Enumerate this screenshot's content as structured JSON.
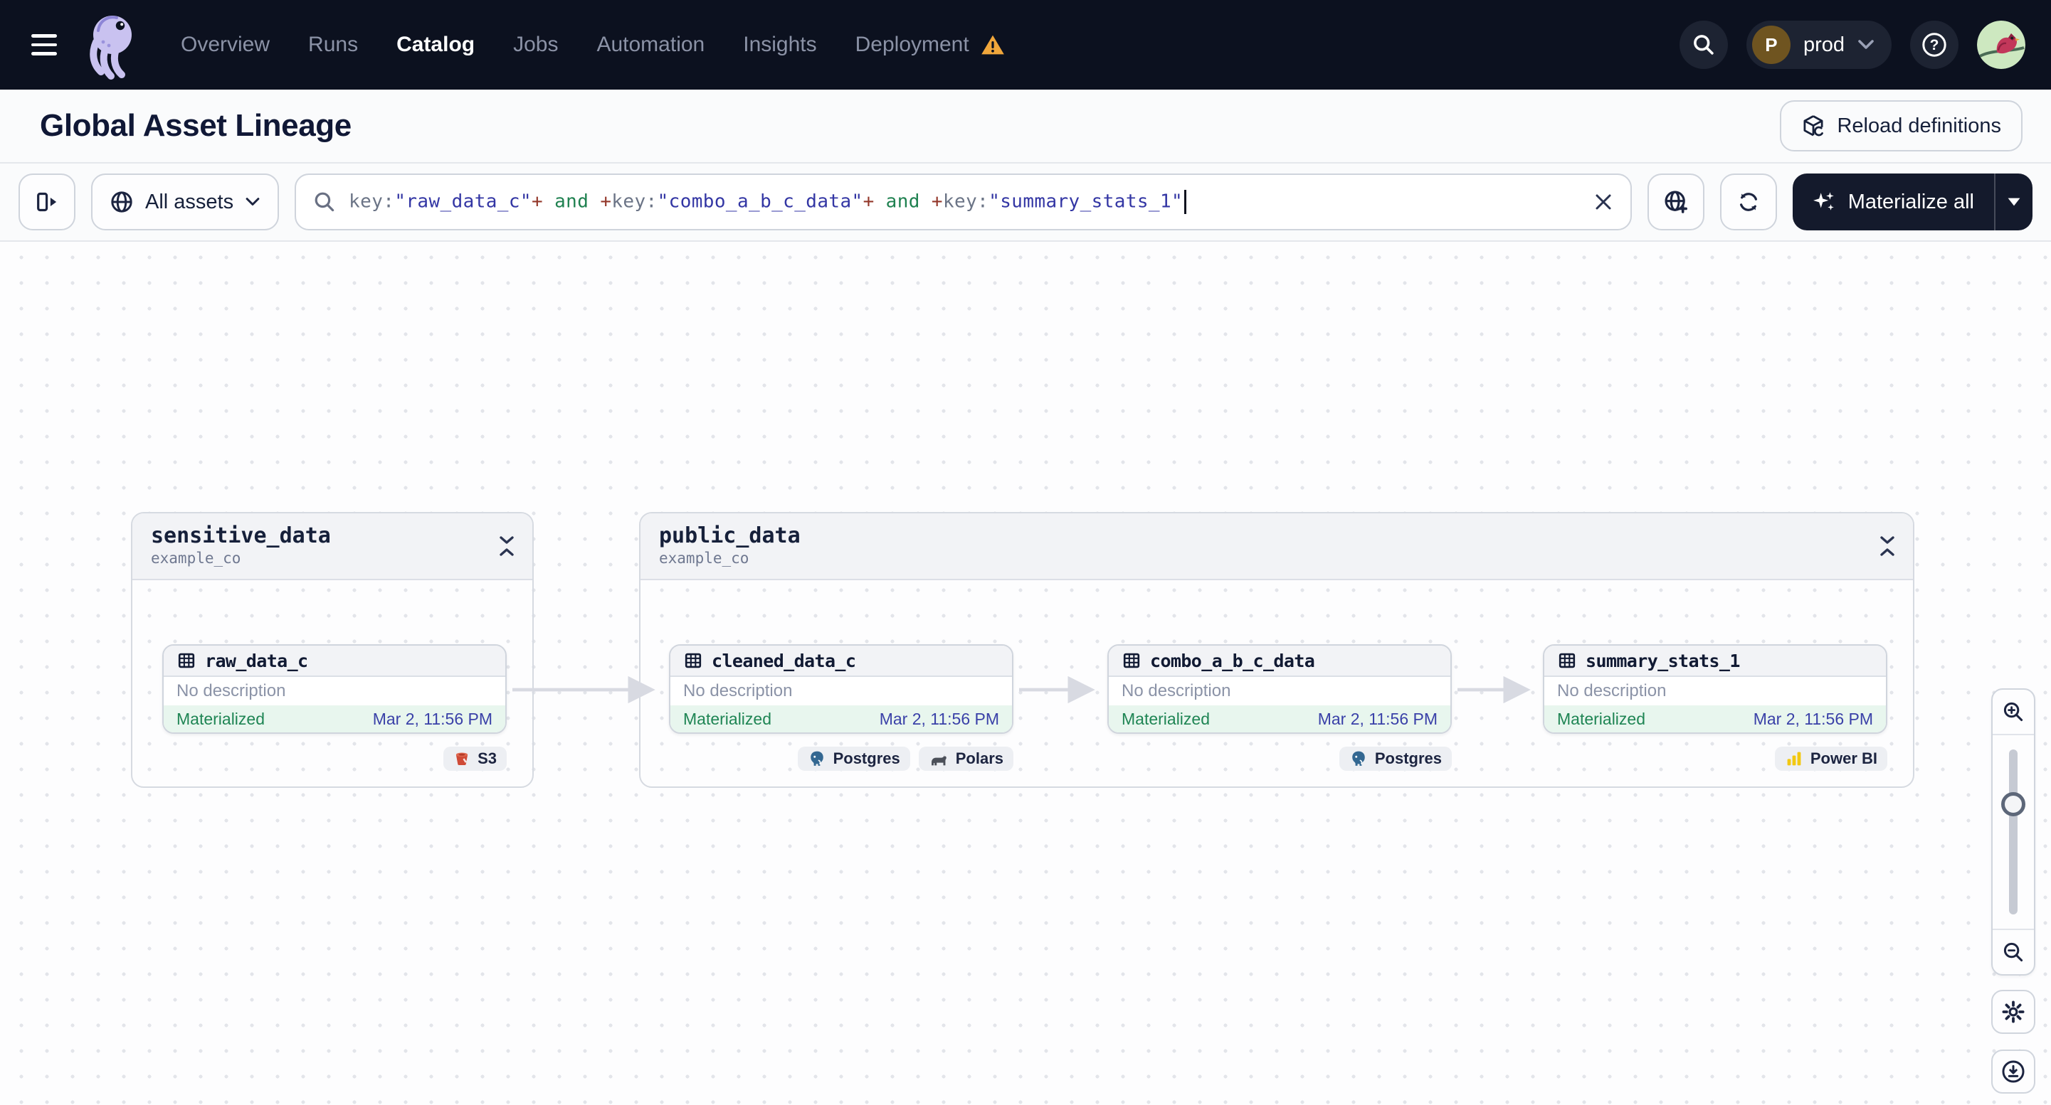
{
  "nav": {
    "items": [
      {
        "label": "Overview",
        "active": false,
        "warning": false
      },
      {
        "label": "Runs",
        "active": false,
        "warning": false
      },
      {
        "label": "Catalog",
        "active": true,
        "warning": false
      },
      {
        "label": "Jobs",
        "active": false,
        "warning": false
      },
      {
        "label": "Automation",
        "active": false,
        "warning": false
      },
      {
        "label": "Insights",
        "active": false,
        "warning": false
      },
      {
        "label": "Deployment",
        "active": false,
        "warning": true
      }
    ],
    "environment": {
      "letter": "P",
      "name": "prod"
    }
  },
  "header": {
    "title": "Global Asset Lineage",
    "reload_label": "Reload definitions"
  },
  "toolbar": {
    "scope_label": "All assets",
    "materialize_label": "Materialize all",
    "query": [
      {
        "text": "key:",
        "kind": "key"
      },
      {
        "text": "\"raw_data_c\"",
        "kind": "str"
      },
      {
        "text": "+",
        "kind": "op"
      },
      {
        "text": " and ",
        "kind": "bool"
      },
      {
        "text": "+",
        "kind": "op"
      },
      {
        "text": "key:",
        "kind": "key"
      },
      {
        "text": "\"combo_a_b_c_data\"",
        "kind": "str"
      },
      {
        "text": "+",
        "kind": "op"
      },
      {
        "text": " and ",
        "kind": "bool"
      },
      {
        "text": "+",
        "kind": "op"
      },
      {
        "text": "key:",
        "kind": "key"
      },
      {
        "text": "\"summary_stats_1\"",
        "kind": "str"
      }
    ]
  },
  "graph": {
    "groups": [
      {
        "name": "sensitive_data",
        "location": "example_co"
      },
      {
        "name": "public_data",
        "location": "example_co"
      }
    ],
    "assets": [
      {
        "name": "raw_data_c",
        "description": "No description",
        "status": "Materialized",
        "timestamp": "Mar 2, 11:56 PM",
        "group": "sensitive_data",
        "tags": [
          {
            "label": "S3",
            "icon": "s3-bucket-icon"
          }
        ]
      },
      {
        "name": "cleaned_data_c",
        "description": "No description",
        "status": "Materialized",
        "timestamp": "Mar 2, 11:56 PM",
        "group": "public_data",
        "tags": [
          {
            "label": "Postgres",
            "icon": "postgres-elephant-icon"
          },
          {
            "label": "Polars",
            "icon": "polars-bear-icon"
          }
        ]
      },
      {
        "name": "combo_a_b_c_data",
        "description": "No description",
        "status": "Materialized",
        "timestamp": "Mar 2, 11:56 PM",
        "group": "public_data",
        "tags": [
          {
            "label": "Postgres",
            "icon": "postgres-elephant-icon"
          }
        ]
      },
      {
        "name": "summary_stats_1",
        "description": "No description",
        "status": "Materialized",
        "timestamp": "Mar 2, 11:56 PM",
        "group": "public_data",
        "tags": [
          {
            "label": "Power BI",
            "icon": "powerbi-icon"
          }
        ]
      }
    ],
    "edges": [
      [
        "raw_data_c",
        "cleaned_data_c"
      ],
      [
        "cleaned_data_c",
        "combo_a_b_c_data"
      ],
      [
        "combo_a_b_c_data",
        "summary_stats_1"
      ]
    ]
  },
  "colors": {
    "nav_background": "#0c111f",
    "warning_amber": "#f1a73b",
    "status_green": "#1f8554",
    "status_green_bg": "#e8f6ee",
    "timestamp_indigo": "#3a41a8",
    "query_key": "#6b7486",
    "query_string": "#3336a4",
    "query_operator": "#93372a",
    "query_boolean": "#1f8150",
    "edge_gray": "#d8dae2",
    "materialize_bg": "#141a2c"
  }
}
